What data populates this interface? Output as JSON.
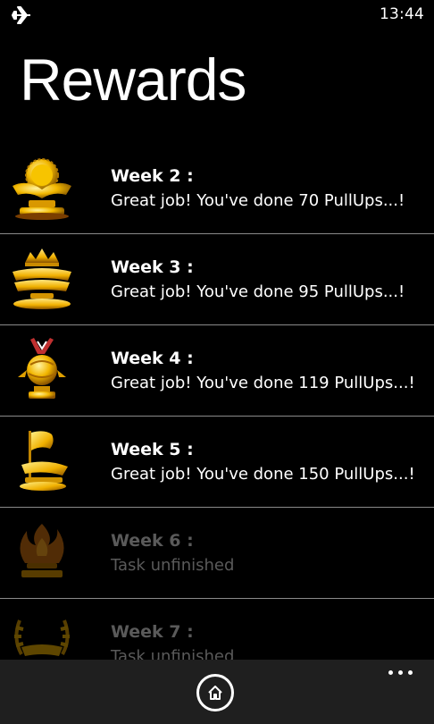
{
  "status_bar": {
    "icon": "airplane-icon",
    "time": "13:44"
  },
  "page": {
    "title": "Rewards"
  },
  "rewards": [
    {
      "week": "Week 2 :",
      "message": "Great job! You've done 70 PullUps...!",
      "icon": "trophy-cup-icon",
      "unlocked": true
    },
    {
      "week": "Week 3 :",
      "message": "Great job! You've done 95 PullUps...!",
      "icon": "crown-trophy-icon",
      "unlocked": true
    },
    {
      "week": "Week 4 :",
      "message": "Great job! You've done 119 PullUps...!",
      "icon": "medal-trophy-icon",
      "unlocked": true
    },
    {
      "week": "Week 5 :",
      "message": "Great job! You've done 150 PullUps...!",
      "icon": "flag-trophy-icon",
      "unlocked": true
    },
    {
      "week": "Week 6 :",
      "message": "Task unfinished",
      "icon": "flame-trophy-icon",
      "unlocked": false
    },
    {
      "week": "Week 7 :",
      "message": "Task unfinished",
      "icon": "laurel-trophy-icon",
      "unlocked": false
    }
  ],
  "app_bar": {
    "home_icon": "home-icon",
    "more_icon": "more-options-icon"
  },
  "colors": {
    "background": "#000000",
    "gold": "#f0b800",
    "divider": "#8a8a8a",
    "locked_text": "#5a5a5a",
    "app_bar": "#1f1f1f"
  }
}
